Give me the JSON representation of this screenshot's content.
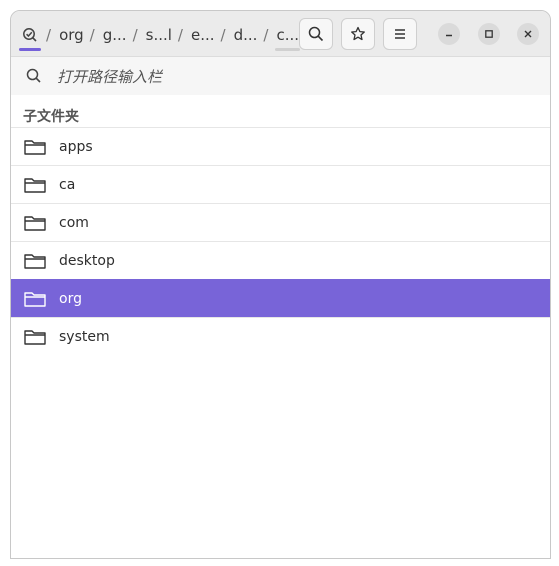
{
  "breadcrumbs": {
    "root_icon": "filesystem-root-icon",
    "separator": "/",
    "items": [
      "org",
      "g...",
      "s...l",
      "e...",
      "d...",
      "c..."
    ]
  },
  "header_buttons": {
    "search_icon": "search-icon",
    "bookmark_icon": "star-icon",
    "menu_icon": "menu-icon"
  },
  "window_controls": {
    "minimize_icon": "minimize-icon",
    "maximize_icon": "maximize-icon",
    "close_icon": "close-icon"
  },
  "search": {
    "placeholder": "打开路径输入栏"
  },
  "section": {
    "label": "子文件夹"
  },
  "folders": [
    {
      "name": "apps",
      "selected": false
    },
    {
      "name": "ca",
      "selected": false
    },
    {
      "name": "com",
      "selected": false
    },
    {
      "name": "desktop",
      "selected": false
    },
    {
      "name": "org",
      "selected": true
    },
    {
      "name": "system",
      "selected": false
    }
  ],
  "colors": {
    "accent": "#7864d8",
    "header_bg": "#ebebeb"
  }
}
